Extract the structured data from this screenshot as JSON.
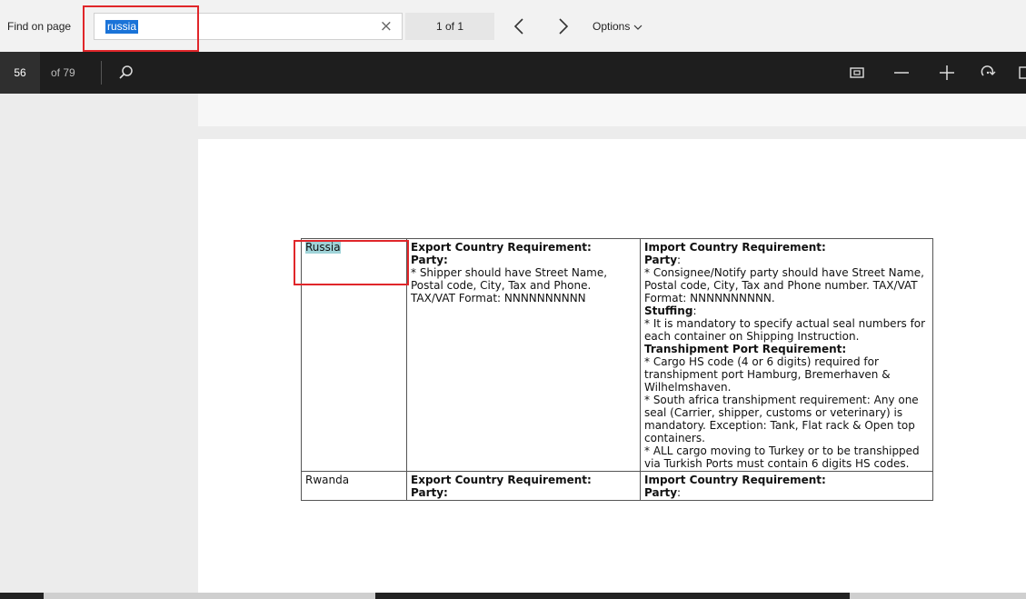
{
  "find_bar": {
    "label": "Find on page",
    "query": "russia",
    "clear_glyph": "×",
    "match_count": "1 of 1",
    "options_label": "Options"
  },
  "toolbar": {
    "current_page": "56",
    "page_total": "of 79"
  },
  "icons": [
    "clear-icon",
    "previous-match-icon",
    "next-match-icon",
    "options-chevron-icon",
    "search-icon",
    "fit-page-icon",
    "zoom-out-icon",
    "zoom-in-icon",
    "rotate-icon"
  ],
  "colors": {
    "highlight": "#9fd3d8",
    "annotation_red": "#e0262a",
    "toolbar": "#1e1e1e",
    "selection": "#1a73d8"
  },
  "document": {
    "rows": [
      {
        "country": "Russia",
        "export": {
          "heading": "Export Country Requirement:",
          "party_label": "Party:",
          "text": "* Shipper should have Street Name, Postal code, City, Tax and Phone. TAX/VAT Format: NNNNNNNNNN"
        },
        "import": {
          "heading": "Import Country Requirement:",
          "party_label": "Party",
          "party_text": "* Consignee/Notify party should have Street Name, Postal code, City, Tax and Phone number. TAX/VAT Format: NNNNNNNNNN.",
          "stuffing_label": "Stuffing",
          "stuffing_text": "* It is mandatory to specify actual seal numbers for each container on Shipping Instruction.",
          "tranship_label": "Transhipment Port Requirement:",
          "tranship_text_1": "* Cargo HS code (4 or 6 digits) required for transhipment port Hamburg, Bremerhaven & Wilhelmshaven.",
          "tranship_text_2": "* South africa transhipment requirement: Any one seal (Carrier, shipper, customs or veterinary) is mandatory. Exception: Tank, Flat rack & Open top containers.",
          "tranship_text_3": "* ALL cargo moving to Turkey or to be transhipped via Turkish Ports must contain 6 digits HS codes."
        }
      },
      {
        "country": "Rwanda",
        "export": {
          "heading": "Export Country Requirement:",
          "party_label": "Party:"
        },
        "import": {
          "heading": "Import Country Requirement:",
          "party_label": "Party"
        }
      }
    ]
  }
}
